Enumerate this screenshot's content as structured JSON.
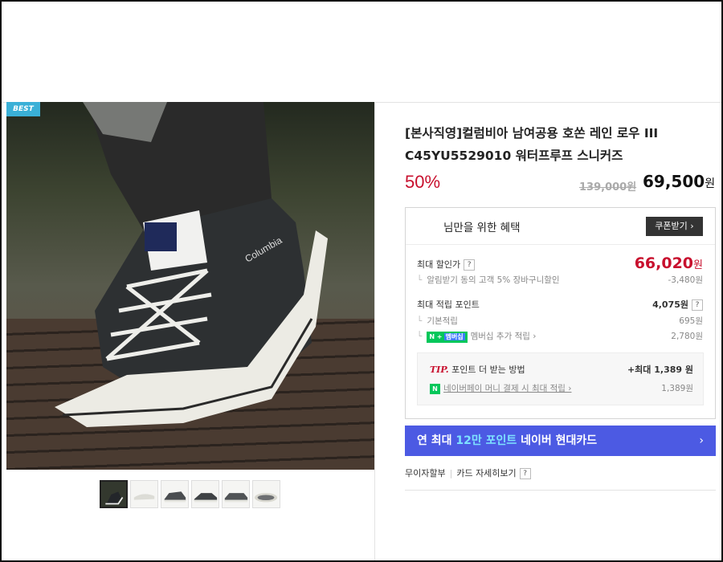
{
  "badge": "BEST",
  "product": {
    "title": "[본사직영]컬럼비아 남여공용 호쏜 레인 로우 III C45YU5529010 워터프루프 스니커즈",
    "discount_rate": "50%",
    "original_price": "139,000원",
    "sale_price": "69,500",
    "currency": "원"
  },
  "benefits": {
    "title": "님만을 위한 혜택",
    "coupon_button": "쿠폰받기 ›",
    "max_discount_label": "최대 할인가",
    "max_discount_value": "66,020",
    "alarm_label": "알림받기 동의 고객 5% 장바구니할인",
    "alarm_value": "-3,480원",
    "max_points_label": "최대 적립 포인트",
    "max_points_value": "4,075원",
    "basic_label": "기본적립",
    "basic_value": "695원",
    "membership_badge_n": "N +",
    "membership_badge_mem": "멤버십",
    "membership_label": "멤버십 추가 적립 ›",
    "membership_value": "2,780원",
    "help_glyph": "?",
    "currency": "원"
  },
  "tip": {
    "label": "TIP.",
    "text": "포인트 더 받는 방법",
    "max_label": "+최대 1,389 원",
    "npay_icon": "N",
    "npay_label": "네이버페이 머니 결제 시 최대 적립 ›",
    "npay_value": "1,389원"
  },
  "card_banner": {
    "prefix": "연 최대 ",
    "highlight": "12만 포인트",
    "suffix": " 네이버 현대카드",
    "chevron": "›"
  },
  "installment": {
    "label": "무이자할부",
    "separator": "|",
    "card_detail": "카드 자세히보기",
    "help": "?"
  },
  "colors": {
    "discount_red": "#c8102e",
    "banner_blue": "#4c5ae3",
    "banner_highlight": "#7de1ff",
    "best_badge": "#3ab0d7",
    "npay_green": "#03c75a"
  },
  "thumbnails": [
    "thumb-1",
    "thumb-2",
    "thumb-3",
    "thumb-4",
    "thumb-5",
    "thumb-6"
  ]
}
